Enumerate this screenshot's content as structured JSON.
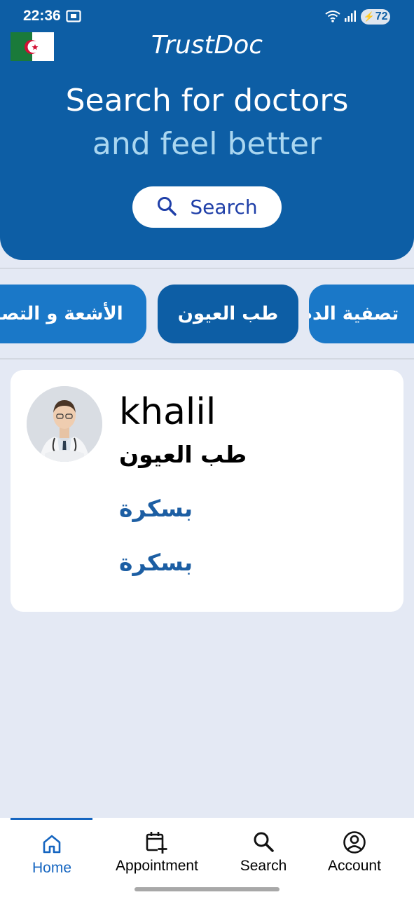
{
  "status_bar": {
    "time": "22:36",
    "battery": "72"
  },
  "header": {
    "app_title": "TrustDoc",
    "hero_line1": "Search for doctors",
    "hero_line2": "and feel better",
    "search_button": "Search",
    "flag": "algeria-flag"
  },
  "categories": [
    {
      "label": "الأشعة و التصوير"
    },
    {
      "label": "طب العيون",
      "selected": true
    },
    {
      "label": "تصفية الدم"
    }
  ],
  "doctor": {
    "name": "khalil",
    "specialty": "طب العيون",
    "city": "بسكرة",
    "location": "بسكرة"
  },
  "nav": {
    "home": "Home",
    "appointment": "Appointment",
    "search": "Search",
    "account": "Account",
    "active": "home"
  },
  "colors": {
    "primary": "#0d5ea5",
    "chip": "#1a78c8",
    "accent_text": "#a9d6f0",
    "background": "#e4e9f4",
    "link": "#1c5ea3"
  }
}
